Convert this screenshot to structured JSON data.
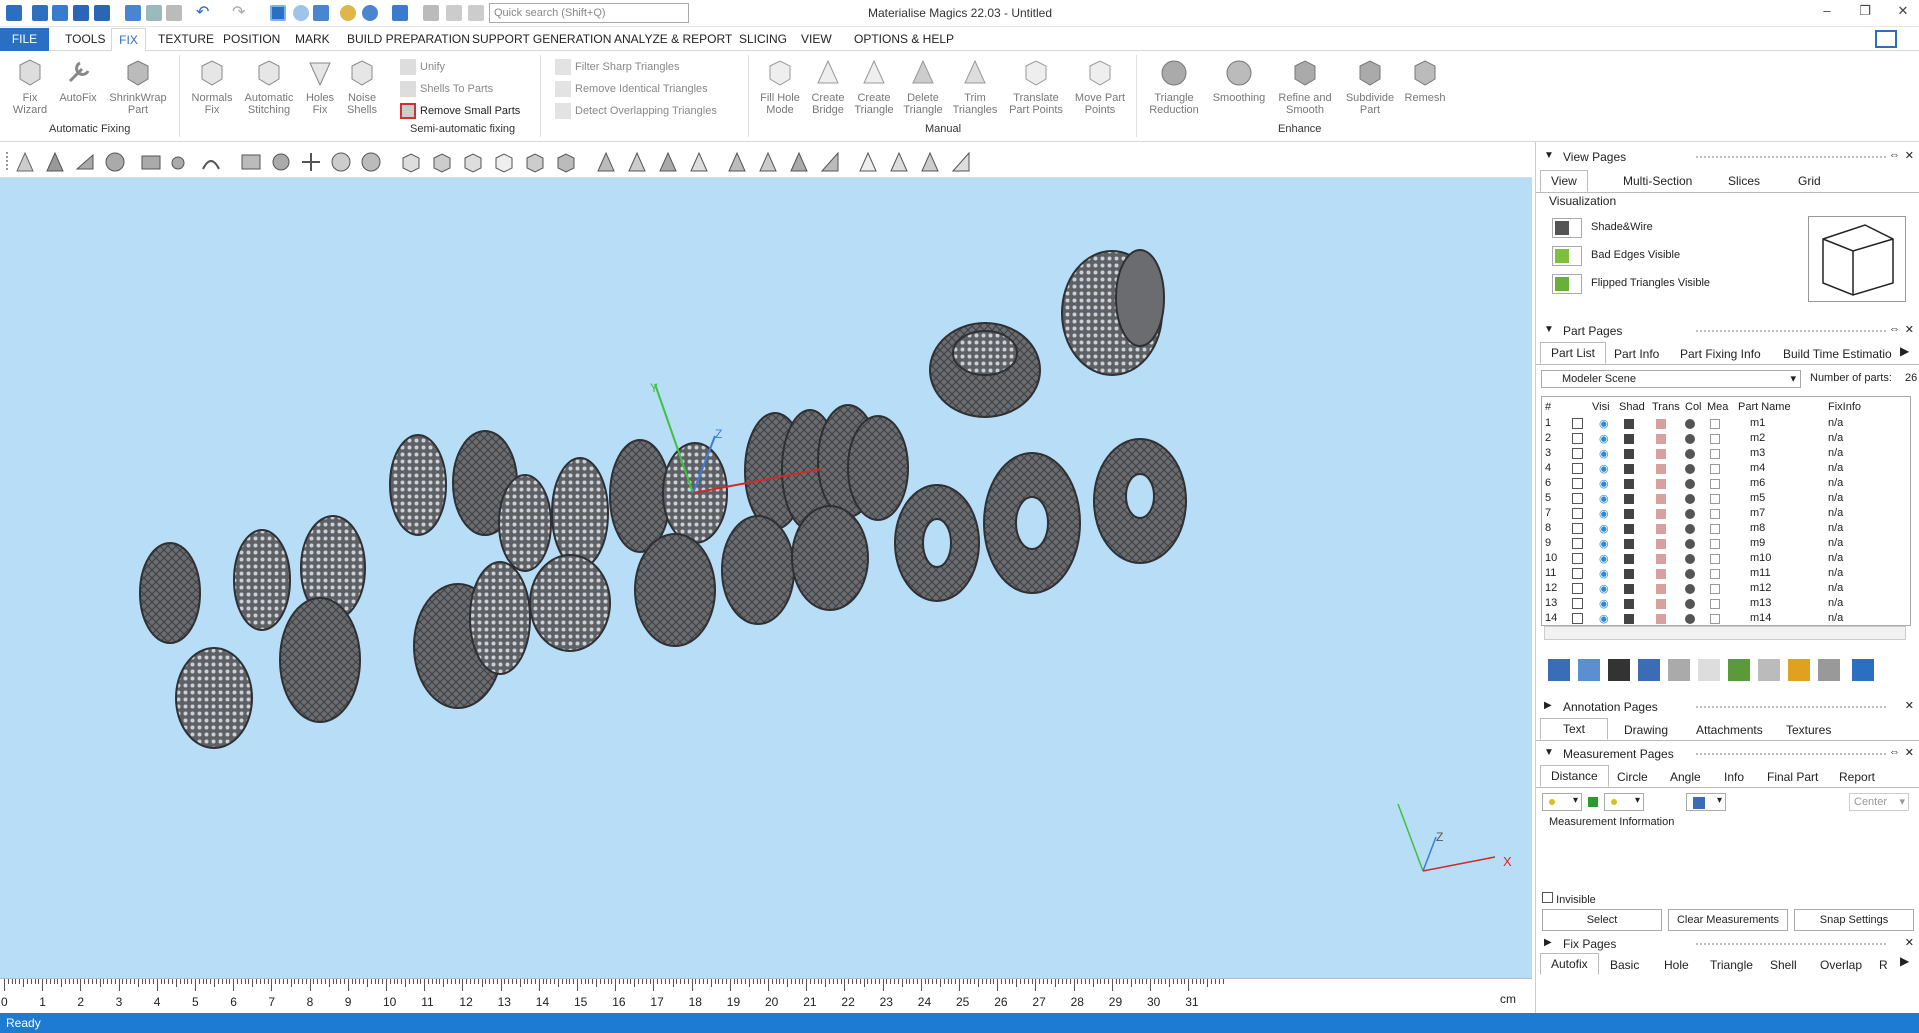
{
  "app": {
    "title": "Materialise Magics 22.03 - Untitled",
    "search_placeholder": "Quick search (Shift+Q)"
  },
  "ribbon_tabs": [
    "FILE",
    "TOOLS",
    "FIX",
    "TEXTURE",
    "POSITION",
    "MARK",
    "BUILD PREPARATION",
    "SUPPORT GENERATION",
    "ANALYZE & REPORT",
    "SLICING",
    "VIEW",
    "OPTIONS & HELP"
  ],
  "ribbon": {
    "automatic_fixing": {
      "group": "Automatic Fixing",
      "buttons": [
        "Fix Wizard",
        "AutoFix",
        "ShrinkWrap Part"
      ]
    },
    "semi_automatic": {
      "group": "Semi-automatic fixing",
      "buttons": [
        "Normals Fix",
        "Automatic Stitching",
        "Holes Fix",
        "Noise Shells"
      ],
      "small": [
        "Unify",
        "Shells To Parts",
        "Remove Small Parts"
      ]
    },
    "filters": [
      "Filter Sharp Triangles",
      "Remove Identical Triangles",
      "Detect Overlapping Triangles"
    ],
    "manual": {
      "group": "Manual",
      "buttons": [
        "Fill Hole Mode",
        "Create Bridge",
        "Create Triangle",
        "Delete Triangle",
        "Trim Triangles",
        "Translate Part Points",
        "Move Part Points"
      ]
    },
    "enhance": {
      "group": "Enhance",
      "buttons": [
        "Triangle Reduction",
        "Smoothing",
        "Refine and Smooth",
        "Subdivide Part",
        "Remesh"
      ]
    }
  },
  "ruler": {
    "unit": "cm",
    "labels": [
      "0",
      "1",
      "2",
      "3",
      "4",
      "5",
      "6",
      "7",
      "8",
      "9",
      "10",
      "11",
      "12",
      "13",
      "14",
      "15",
      "16",
      "17",
      "18",
      "19",
      "20",
      "21",
      "22",
      "23",
      "24",
      "25",
      "26",
      "27",
      "28",
      "29",
      "30",
      "31"
    ]
  },
  "status": "Ready",
  "axis_labels": {
    "x": "X",
    "y": "Y",
    "z": "Z"
  },
  "view_pages": {
    "title": "View Pages",
    "tabs": [
      "View",
      "Multi-Section",
      "Slices",
      "Grid"
    ],
    "visualization_label": "Visualization",
    "options": [
      "Shade&Wire",
      "Bad Edges Visible",
      "Flipped Triangles Visible"
    ]
  },
  "part_pages": {
    "title": "Part Pages",
    "tabs": [
      "Part List",
      "Part Info",
      "Part Fixing Info",
      "Build Time Estimatio"
    ],
    "scene": "Modeler Scene",
    "num_parts_label": "Number of parts:",
    "num_parts": "26",
    "columns": [
      "#",
      "Visi",
      "Shad",
      "Trans",
      "Col",
      "Mea",
      "Part Name",
      "FixInfo"
    ],
    "rows": [
      {
        "n": "1",
        "name": "m1",
        "fix": "n/a"
      },
      {
        "n": "2",
        "name": "m2",
        "fix": "n/a"
      },
      {
        "n": "3",
        "name": "m3",
        "fix": "n/a"
      },
      {
        "n": "4",
        "name": "m4",
        "fix": "n/a"
      },
      {
        "n": "6",
        "name": "m6",
        "fix": "n/a"
      },
      {
        "n": "5",
        "name": "m5",
        "fix": "n/a"
      },
      {
        "n": "7",
        "name": "m7",
        "fix": "n/a"
      },
      {
        "n": "8",
        "name": "m8",
        "fix": "n/a"
      },
      {
        "n": "9",
        "name": "m9",
        "fix": "n/a"
      },
      {
        "n": "10",
        "name": "m10",
        "fix": "n/a"
      },
      {
        "n": "11",
        "name": "m11",
        "fix": "n/a"
      },
      {
        "n": "12",
        "name": "m12",
        "fix": "n/a"
      },
      {
        "n": "13",
        "name": "m13",
        "fix": "n/a"
      },
      {
        "n": "14",
        "name": "m14",
        "fix": "n/a"
      }
    ]
  },
  "annotation_pages": {
    "title": "Annotation Pages",
    "tabs": [
      "Text",
      "Drawing",
      "Attachments",
      "Textures"
    ]
  },
  "measurement_pages": {
    "title": "Measurement Pages",
    "tabs": [
      "Distance",
      "Circle",
      "Angle",
      "Info",
      "Final Part",
      "Report"
    ],
    "center": "Center",
    "info_label": "Measurement Information",
    "invisible_label": "Invisible",
    "buttons": [
      "Select",
      "Clear Measurements",
      "Snap Settings"
    ]
  },
  "fix_pages": {
    "title": "Fix Pages",
    "tabs": [
      "Autofix",
      "Basic",
      "Hole",
      "Triangle",
      "Shell",
      "Overlap",
      "R"
    ]
  }
}
